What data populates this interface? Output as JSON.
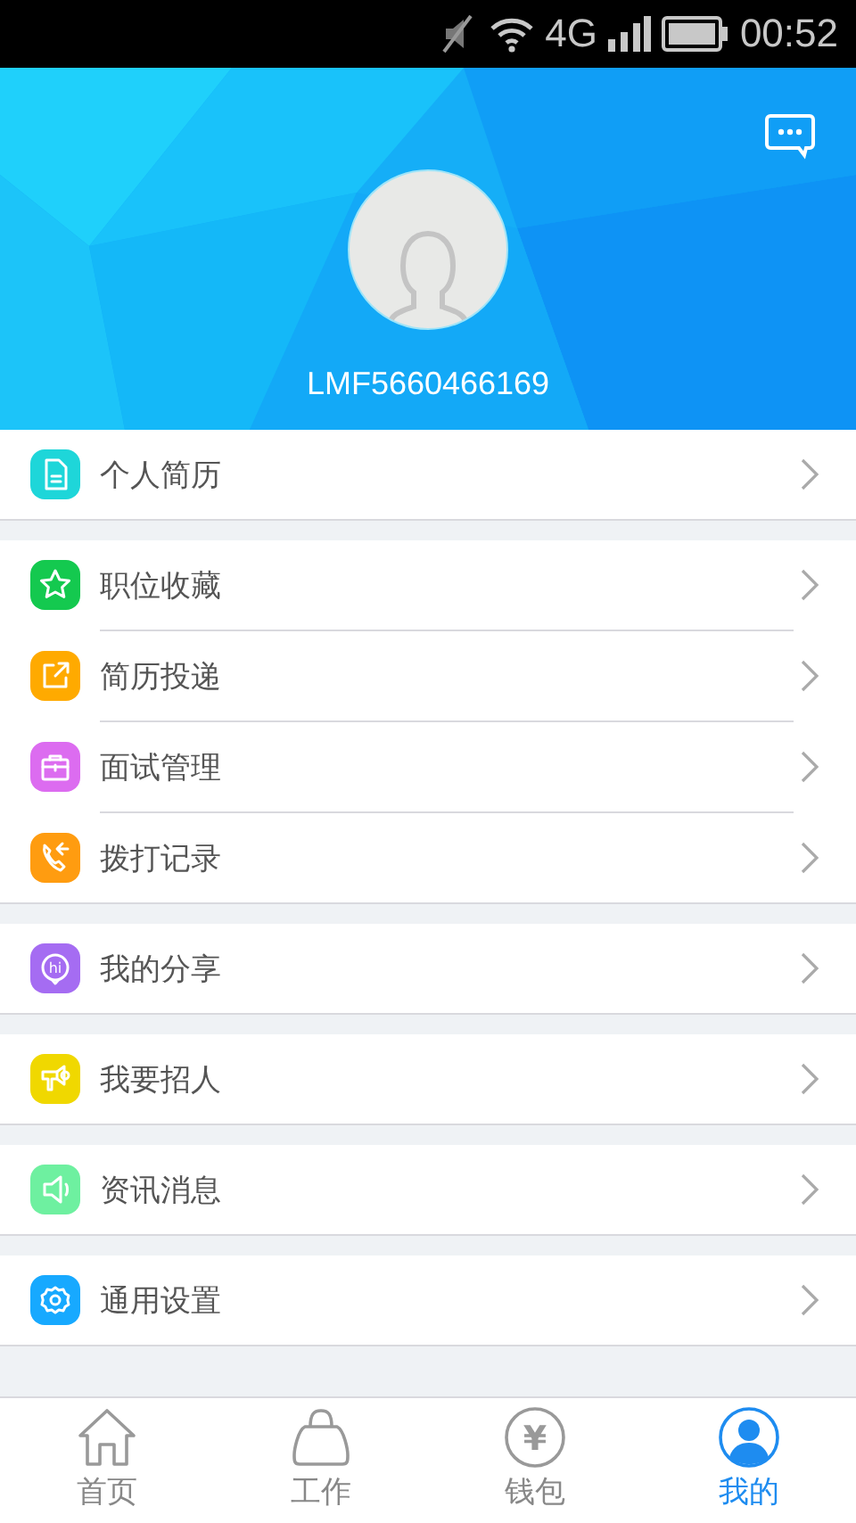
{
  "status_bar": {
    "network": "4G",
    "time": "00:52"
  },
  "profile": {
    "username": "LMF5660466169"
  },
  "groups": [
    {
      "items": [
        {
          "label": "个人简历",
          "kind": "document",
          "color": "#1ed6d9"
        }
      ]
    },
    {
      "items": [
        {
          "label": "职位收藏",
          "kind": "star",
          "color": "#14c94f"
        },
        {
          "label": "简历投递",
          "kind": "send",
          "color": "#ffaa00"
        },
        {
          "label": "面试管理",
          "kind": "briefcase",
          "color": "#dc6cf0"
        },
        {
          "label": "拨打记录",
          "kind": "phone",
          "color": "#ff9c10"
        }
      ]
    },
    {
      "items": [
        {
          "label": "我的分享",
          "kind": "share",
          "color": "#a56cf2",
          "icon_text": "hi"
        }
      ]
    },
    {
      "items": [
        {
          "label": "我要招人",
          "kind": "megaphone",
          "color": "#f0d800"
        }
      ]
    },
    {
      "items": [
        {
          "label": "资讯消息",
          "kind": "speaker",
          "color": "#6ef0a0"
        }
      ]
    },
    {
      "items": [
        {
          "label": "通用设置",
          "kind": "gear",
          "color": "#17a9ff"
        }
      ]
    }
  ],
  "tabs": [
    {
      "label": "首页",
      "kind": "home",
      "selected": false
    },
    {
      "label": "工作",
      "kind": "bag",
      "selected": false
    },
    {
      "label": "钱包",
      "kind": "wallet",
      "selected": false,
      "icon_text": "¥"
    },
    {
      "label": "我的",
      "kind": "person",
      "selected": true
    }
  ]
}
